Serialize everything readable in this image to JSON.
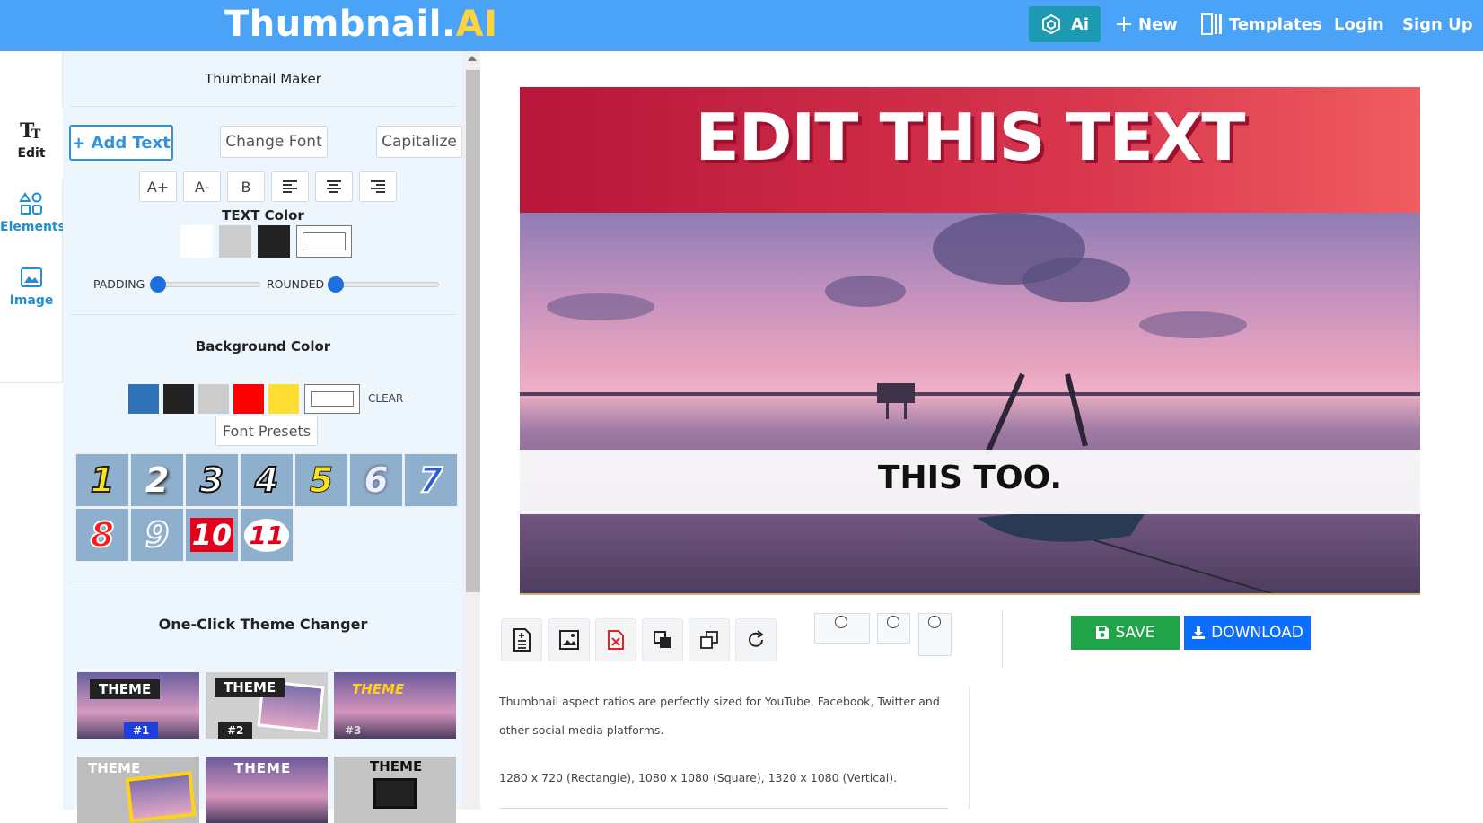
{
  "brand": {
    "name": "Thumbnail.",
    "suffix": "AI"
  },
  "nav": {
    "ai": "Ai",
    "new": "New",
    "templates": "Templates",
    "login": "Login",
    "signup": "Sign Up"
  },
  "rail": {
    "edit": "Edit",
    "elements": "Elements",
    "image": "Image"
  },
  "panel": {
    "title": "Thumbnail Maker",
    "add_text": "+ Add Text",
    "change_font": "Change Font",
    "capitalize": "Capitalize",
    "text_tools": [
      "A+",
      "A-",
      "B"
    ],
    "text_color_label": "TEXT Color",
    "text_colors": [
      "#ffffff",
      "#cccccc",
      "#222222"
    ],
    "padding_label": "PADDING",
    "rounded_label": "ROUNDED",
    "padding_value": 0,
    "rounded_value": 0,
    "bg_color_label": "Background Color",
    "bg_colors": [
      "#2f72b5",
      "#222222",
      "#cccccc",
      "#ff0000",
      "#ffdd33"
    ],
    "clear_label": "CLEAR",
    "font_presets_label": "Font Presets",
    "presets": [
      "1",
      "2",
      "3",
      "4",
      "5",
      "6",
      "7",
      "8",
      "9",
      "10",
      "11"
    ],
    "theme_changer_label": "One-Click Theme Changer",
    "themes": [
      "THEME",
      "THEME",
      "THEME",
      "THEME",
      "THEME",
      "THEME"
    ],
    "theme_numbers": [
      "#1",
      "#2",
      "#3"
    ]
  },
  "canvas": {
    "headline": "EDIT THIS TEXT",
    "subline": "THIS TOO."
  },
  "actions": {
    "save": "SAVE",
    "download": "DOWNLOAD"
  },
  "info": {
    "line1": "Thumbnail aspect ratios are perfectly sized for YouTube, Facebook, Twitter and",
    "line2": "other social media platforms.",
    "line3": "1280 x 720 (Rectangle), 1080 x 1080 (Square), 1320 x 1080 (Vertical)."
  },
  "colors": {
    "topbar": "#4aa3f7",
    "accent": "#2f93e0",
    "save": "#21a34a",
    "download": "#0d6efd"
  }
}
